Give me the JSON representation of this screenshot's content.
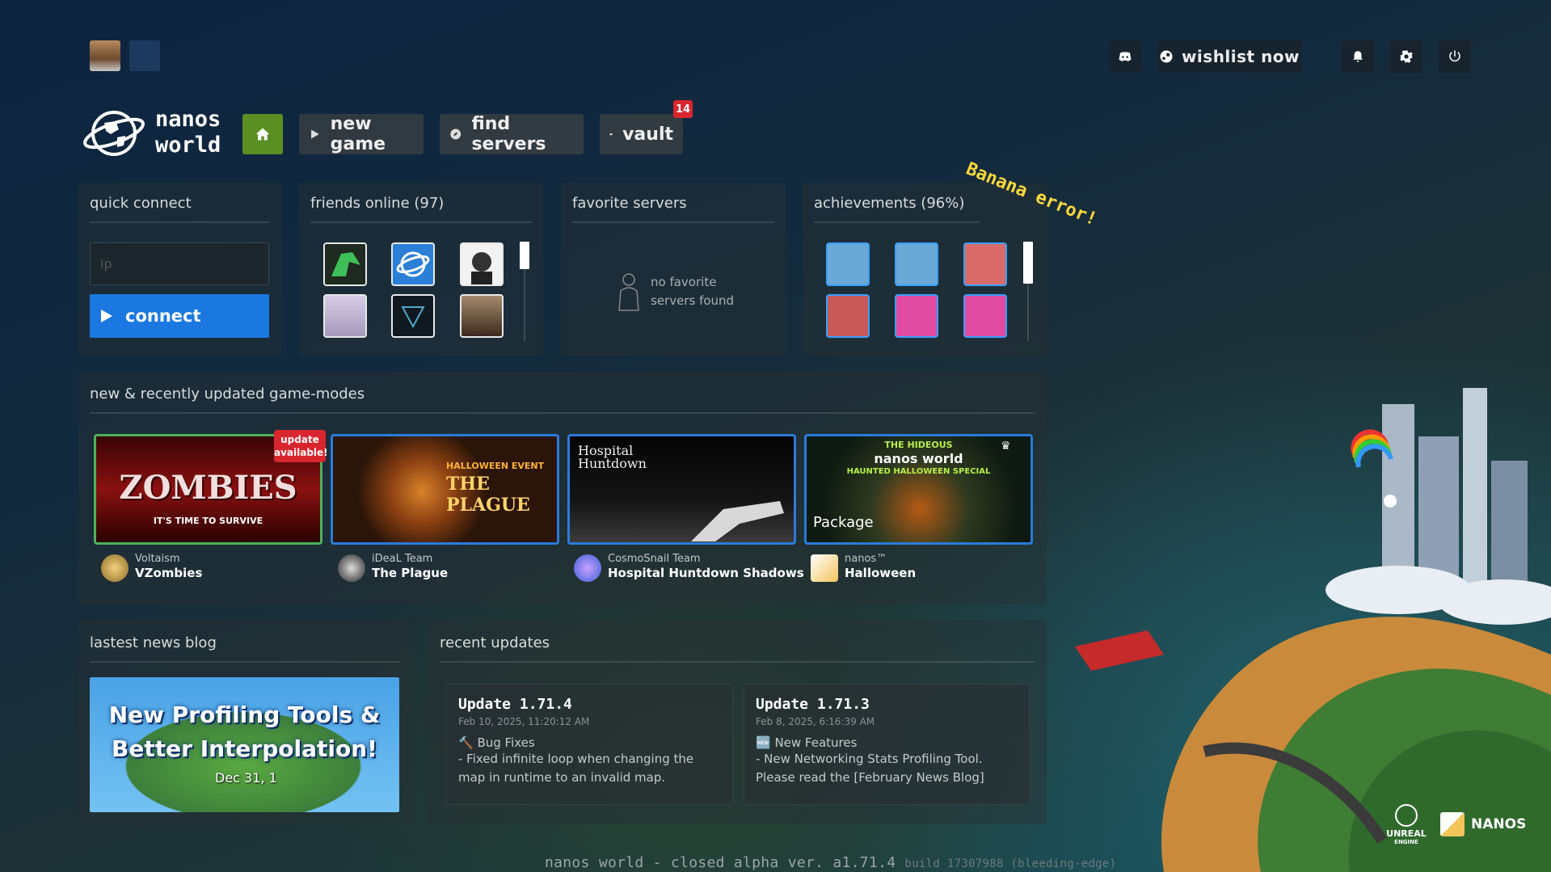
{
  "topbar": {
    "wishlist_label": "wishlist now",
    "icons": [
      "discord-icon",
      "steam-icon",
      "bell-icon",
      "gear-icon",
      "power-icon"
    ]
  },
  "logo": {
    "line1": "nanos",
    "line2": "world"
  },
  "nav": {
    "new_game": "new game",
    "find_servers": "find servers",
    "vault": "vault",
    "vault_badge": "14"
  },
  "quick_connect": {
    "title": "quick connect",
    "placeholder": "ip",
    "connect_label": "connect"
  },
  "friends": {
    "title": "friends online (97)"
  },
  "favorites": {
    "title": "favorite servers",
    "empty_line1": "no favorite",
    "empty_line2": "servers found"
  },
  "achievements": {
    "title": "achievements (96%)"
  },
  "banana": "Banana error!",
  "game_modes": {
    "title": "new & recently updated game-modes",
    "update_badge_line1": "update",
    "update_badge_line2": "available!",
    "items": [
      {
        "author": "Voltaism",
        "name": "VZombies",
        "thumb_text": "ZOMBIES",
        "thumb_sub": "IT'S TIME TO SURVIVE"
      },
      {
        "author": "iDeaL Team",
        "name": "The Plague",
        "thumb_text": "THE PLAGUE",
        "thumb_sub": "HALLOWEEN EVENT"
      },
      {
        "author": "CosmoSnail Team",
        "name": "Hospital Huntdown Shadows",
        "thumb_text": "Hospital Huntdown",
        "thumb_sub": ""
      },
      {
        "author": "nanos™",
        "name": "Halloween",
        "thumb_text": "nanos world",
        "thumb_sub": "HAUNTED HALLOWEEN SPECIAL",
        "thumb_top": "THE HIDEOUS",
        "package_label": "Package"
      }
    ]
  },
  "news": {
    "title": "lastest news blog",
    "headline_line1": "New Profiling Tools &",
    "headline_line2": "Better Interpolation!",
    "date": "Dec 31, 1"
  },
  "recent_updates": {
    "title": "recent updates",
    "items": [
      {
        "title": "Update 1.71.4",
        "date": "Feb 10, 2025, 11:20:12 AM",
        "category": "🔨 Bug Fixes",
        "body": "- Fixed infinite loop when changing the map in runtime to an invalid map."
      },
      {
        "title": "Update 1.71.3",
        "date": "Feb 8, 2025, 6:16:39 AM",
        "category": "🆕 New Features",
        "body": "- New Networking Stats Profiling Tool. Please read the [February News Blog]"
      }
    ]
  },
  "footer": {
    "main": "nanos world - closed alpha  ver. a1.71.4",
    "build": "build 17307988  (bleeding-edge)"
  },
  "branding": {
    "unreal_line1": "UNREAL",
    "unreal_line2": "ENGINE",
    "nanos": "NANOS"
  }
}
